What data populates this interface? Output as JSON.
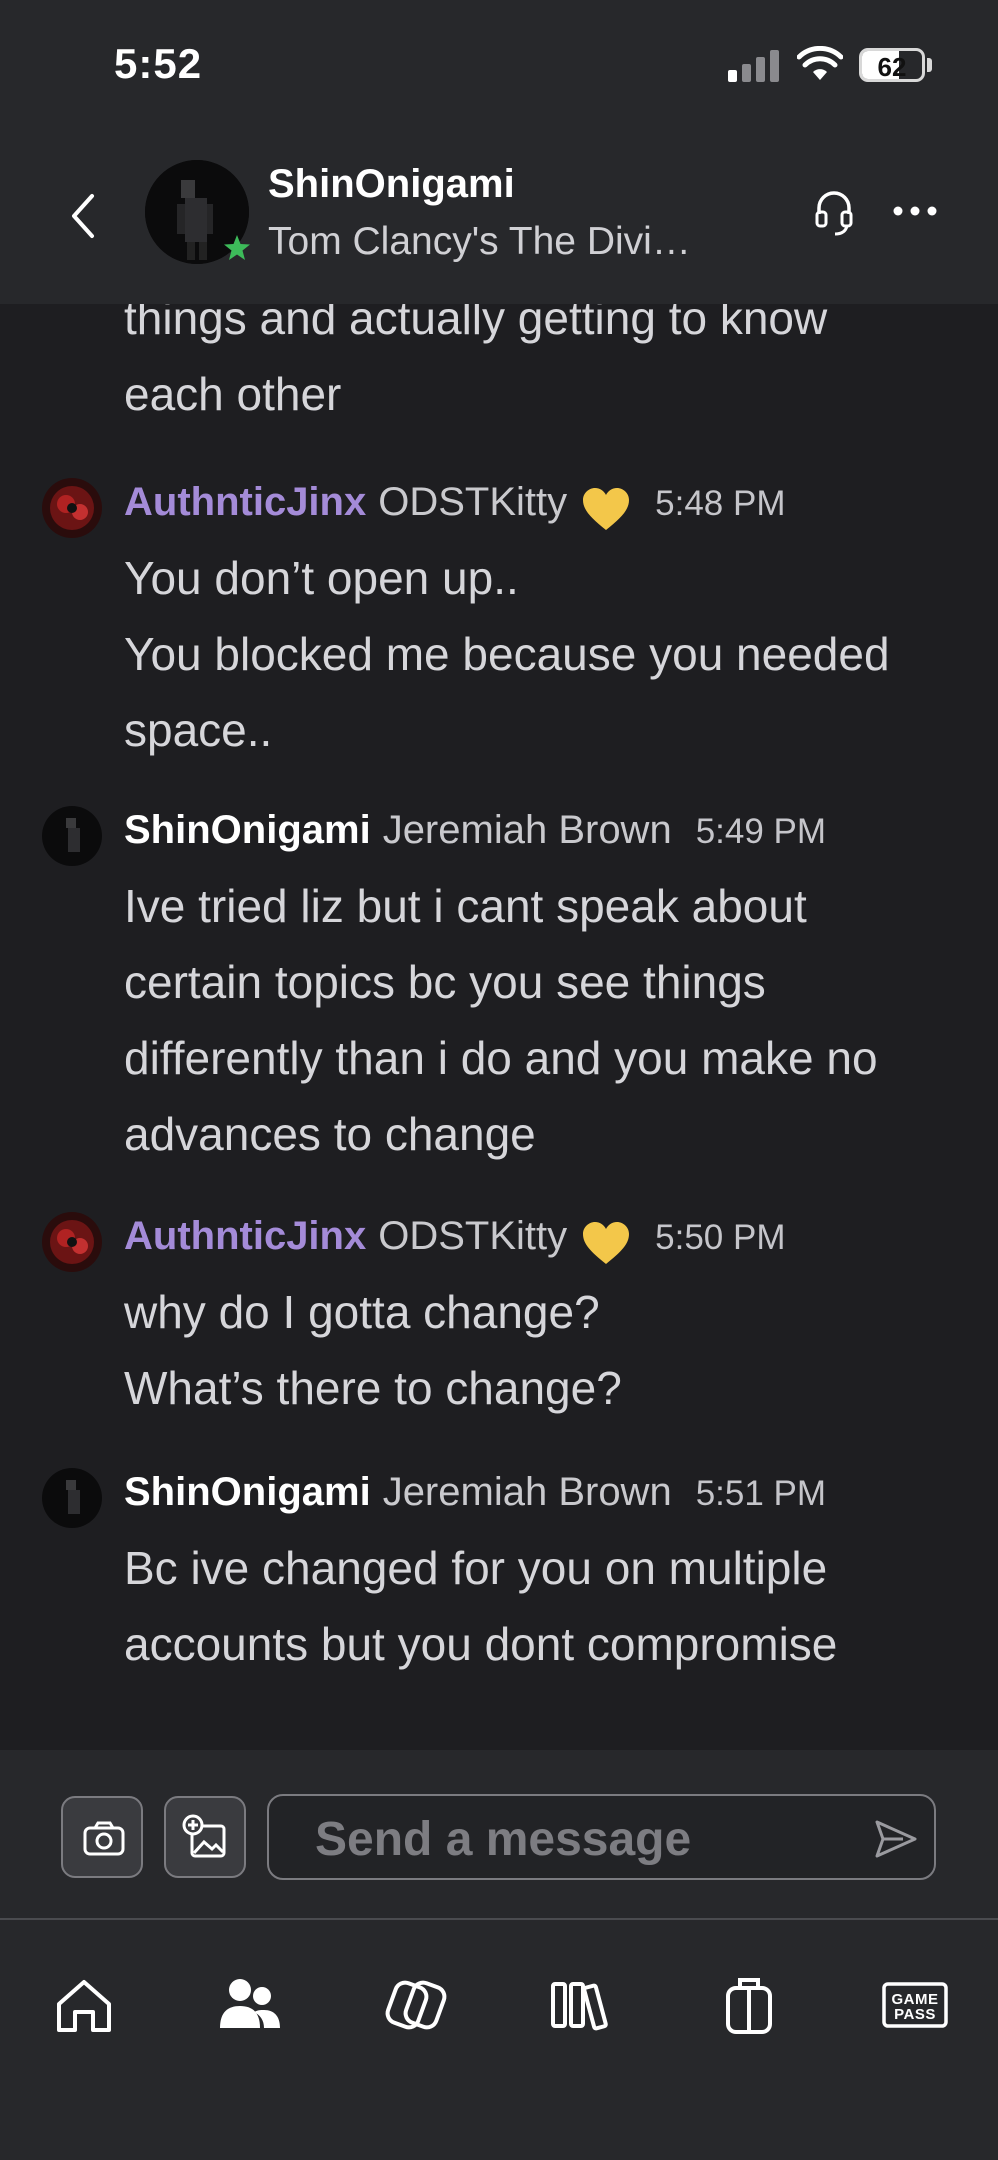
{
  "status_bar": {
    "time": "5:52",
    "battery_percent": "62"
  },
  "chat_header": {
    "contact_name": "ShinOnigami",
    "contact_status": "Tom Clancy's The Divi…"
  },
  "messages": [
    {
      "continuation": true,
      "lines": [
        "things and actually getting to know",
        "each other"
      ]
    },
    {
      "author": "AuthnticJinx",
      "nickname": "ODSTKitty",
      "time": "5:48 PM",
      "lines": [
        "You don’t open up..",
        "You blocked me because you needed",
        "space.."
      ]
    },
    {
      "author": "ShinOnigami",
      "nickname": "Jeremiah Brown",
      "time": "5:49 PM",
      "lines": [
        "Ive tried liz but i cant speak about",
        "certain topics bc you see things",
        "differently than i do and you make no",
        "advances to change"
      ]
    },
    {
      "author": "AuthnticJinx",
      "nickname": "ODSTKitty",
      "time": "5:50 PM",
      "lines": [
        "why do I gotta change?",
        "What’s there to change?"
      ]
    },
    {
      "author": "ShinOnigami",
      "nickname": "Jeremiah Brown",
      "time": "5:51 PM",
      "lines": [
        "Bc ive changed for you on multiple",
        "accounts but you dont compromise"
      ]
    }
  ],
  "composer": {
    "placeholder": "Send a message"
  },
  "bottom_nav": {
    "items": [
      {
        "icon": "home-icon"
      },
      {
        "icon": "friends-icon",
        "active": true
      },
      {
        "icon": "social-icon"
      },
      {
        "icon": "library-icon"
      },
      {
        "icon": "store-icon"
      },
      {
        "icon": "game-pass-icon"
      }
    ],
    "game_pass_line1": "GAME",
    "game_pass_line2": "PASS"
  },
  "colors": {
    "background": "#1e1e21",
    "header": "#27282b",
    "author_purple": "#a48bd8",
    "heart": "#f3c74a",
    "presence": "#3dbb5a"
  }
}
